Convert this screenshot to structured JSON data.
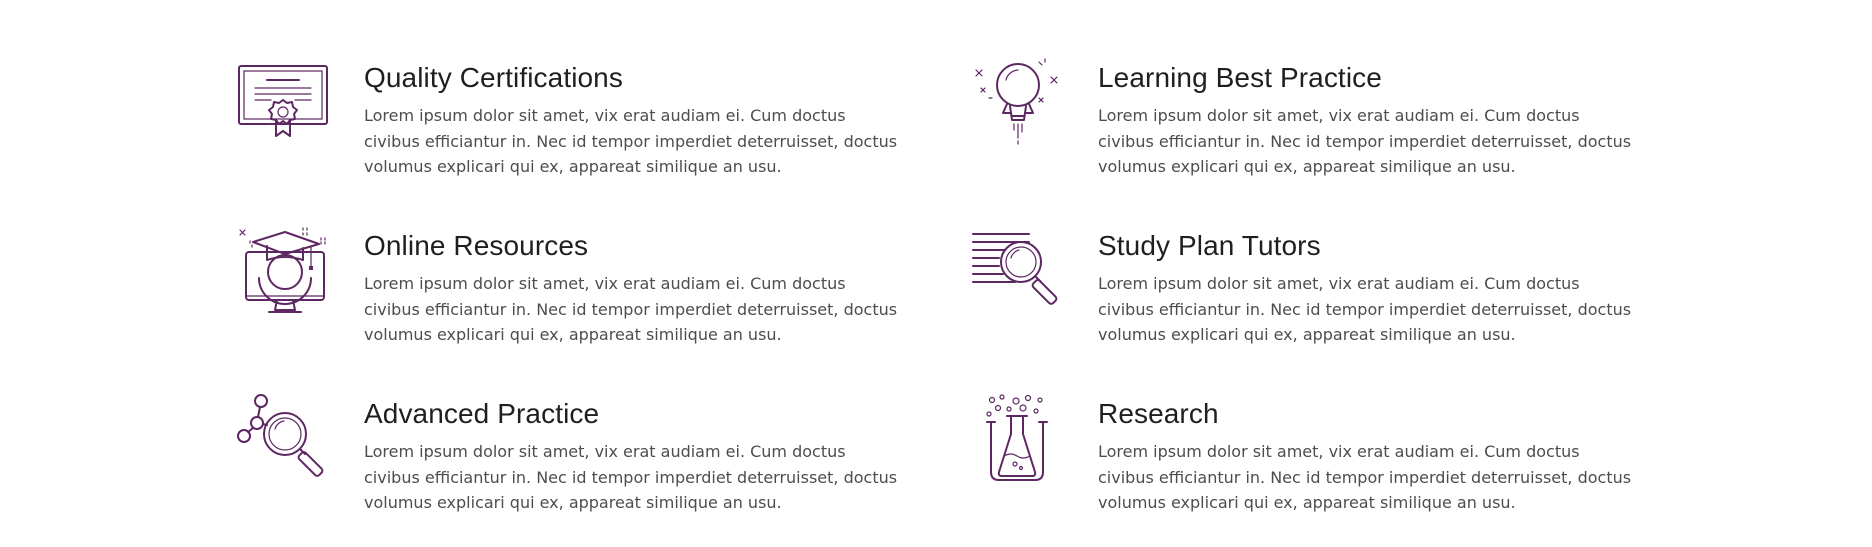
{
  "colors": {
    "accent": "#5d2762",
    "heading": "#1f1f1f",
    "body": "#4d4d4d"
  },
  "features": [
    {
      "icon": "certificate-icon",
      "title": "Quality Certifications",
      "description": "Lorem ipsum dolor sit amet, vix erat audiam ei. Cum doctus civibus efficiantur in. Nec id tempor imperdiet deterruisset, doctus volumus explicari qui ex, appareat similique an usu."
    },
    {
      "icon": "rocket-bulb-icon",
      "title": "Learning Best Practice",
      "description": "Lorem ipsum dolor sit amet, vix erat audiam ei. Cum doctus civibus efficiantur in. Nec id tempor imperdiet deterruisset, doctus volumus explicari qui ex, appareat similique an usu."
    },
    {
      "icon": "graduation-monitor-icon",
      "title": "Online Resources",
      "description": "Lorem ipsum dolor sit amet, vix erat audiam ei. Cum doctus civibus efficiantur in. Nec id tempor imperdiet deterruisset, doctus volumus explicari qui ex, appareat similique an usu."
    },
    {
      "icon": "document-magnifier-icon",
      "title": "Study Plan Tutors",
      "description": "Lorem ipsum dolor sit amet, vix erat audiam ei. Cum doctus civibus efficiantur in. Nec id tempor imperdiet deterruisset, doctus volumus explicari qui ex, appareat similique an usu."
    },
    {
      "icon": "molecule-magnifier-icon",
      "title": "Advanced Practice",
      "description": "Lorem ipsum dolor sit amet, vix erat audiam ei. Cum doctus civibus efficiantur in. Nec id tempor imperdiet deterruisset, doctus volumus explicari qui ex, appareat similique an usu."
    },
    {
      "icon": "flask-icon",
      "title": "Research",
      "description": "Lorem ipsum dolor sit amet, vix erat audiam ei. Cum doctus civibus efficiantur in. Nec id tempor imperdiet deterruisset, doctus volumus explicari qui ex, appareat similique an usu."
    }
  ]
}
